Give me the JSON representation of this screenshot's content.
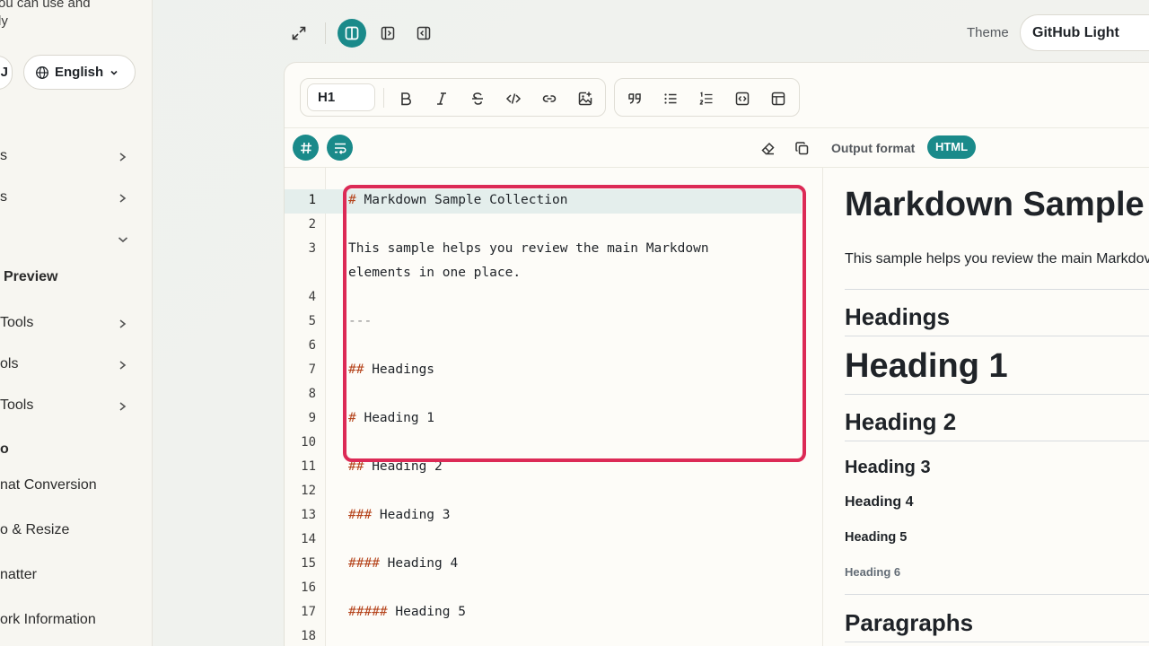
{
  "sidebar": {
    "intro_line1": "ou can use and",
    "intro_line2": "ly",
    "left_pill": "J",
    "language": "English",
    "items": [
      {
        "label": "s",
        "chevron": "right"
      },
      {
        "label": "s",
        "chevron": "right"
      },
      {
        "label": "",
        "chevron": "down"
      },
      {
        "label": "Preview",
        "chevron": "none"
      },
      {
        "label": "Tools",
        "chevron": "right"
      },
      {
        "label": "ols",
        "chevron": "right"
      },
      {
        "label": "Tools",
        "chevron": "right"
      },
      {
        "label": "o",
        "chevron": "none"
      },
      {
        "label": "nat Conversion",
        "chevron": "none"
      },
      {
        "label": "o & Resize",
        "chevron": "none"
      },
      {
        "label": "natter",
        "chevron": "none"
      },
      {
        "label": "ork Information",
        "chevron": "none"
      }
    ]
  },
  "topbar": {
    "theme_label": "Theme",
    "theme_value": "GitHub Light"
  },
  "toolbar": {
    "heading_select": "H1"
  },
  "subbar": {
    "output_label": "Output format",
    "output_value": "HTML"
  },
  "editor": {
    "lines": [
      {
        "n": "1",
        "mark": "#",
        "text": " Markdown Sample Collection"
      },
      {
        "n": "2",
        "mark": "",
        "text": ""
      },
      {
        "n": "3",
        "mark": "",
        "text": "This sample helps you review the main Markdown"
      },
      {
        "n": "",
        "mark": "",
        "text": "elements in one place."
      },
      {
        "n": "4",
        "mark": "",
        "text": ""
      },
      {
        "n": "5",
        "mark": "---",
        "text": ""
      },
      {
        "n": "6",
        "mark": "",
        "text": ""
      },
      {
        "n": "7",
        "mark": "##",
        "text": " Headings"
      },
      {
        "n": "8",
        "mark": "",
        "text": ""
      },
      {
        "n": "9",
        "mark": "#",
        "text": " Heading 1"
      },
      {
        "n": "10",
        "mark": "",
        "text": ""
      },
      {
        "n": "11",
        "mark": "##",
        "text": " Heading 2"
      },
      {
        "n": "12",
        "mark": "",
        "text": ""
      },
      {
        "n": "13",
        "mark": "###",
        "text": " Heading 3"
      },
      {
        "n": "14",
        "mark": "",
        "text": ""
      },
      {
        "n": "15",
        "mark": "####",
        "text": " Heading 4"
      },
      {
        "n": "16",
        "mark": "",
        "text": ""
      },
      {
        "n": "17",
        "mark": "#####",
        "text": " Heading 5"
      },
      {
        "n": "18",
        "mark": "",
        "text": ""
      }
    ]
  },
  "preview": {
    "title": "Markdown Sample C",
    "intro": "This sample helps you review the main Markdov",
    "headings_section": "Headings",
    "h1": "Heading 1",
    "h2": "Heading 2",
    "h3": "Heading 3",
    "h4": "Heading 4",
    "h5": "Heading 5",
    "h6": "Heading 6",
    "paragraphs_section": "Paragraphs"
  },
  "colors": {
    "accent": "#1a8a8a",
    "markdown_marker": "#b5441c",
    "highlight_border": "#dc2a56"
  }
}
